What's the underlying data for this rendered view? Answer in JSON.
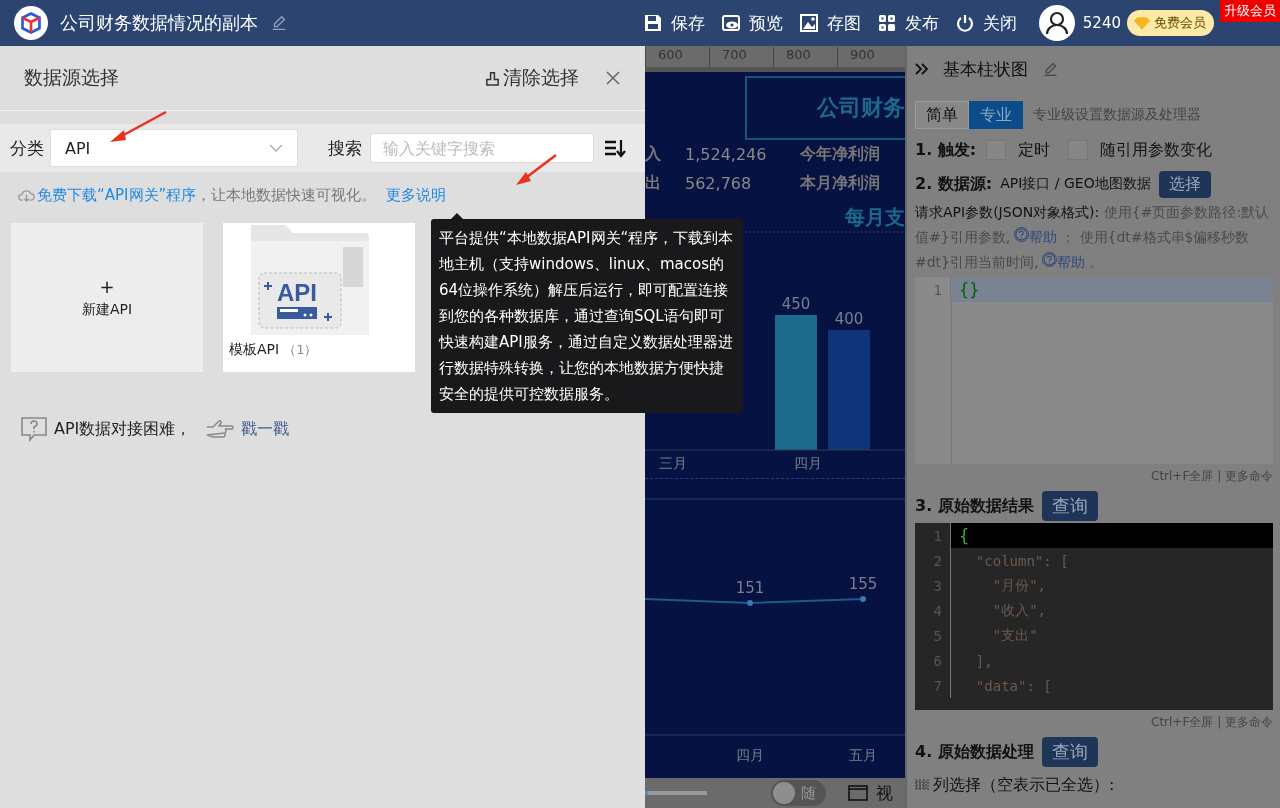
{
  "header": {
    "title": "公司财务数据情况的副本",
    "actions": [
      {
        "kind": "save",
        "label": "保存"
      },
      {
        "kind": "preview",
        "label": "预览"
      },
      {
        "kind": "image",
        "label": "存图"
      },
      {
        "kind": "publish",
        "label": "发布"
      },
      {
        "kind": "close",
        "label": "关闭"
      }
    ],
    "points": "5240",
    "member_badge": "免费会员",
    "upgrade_tag": "升级会员"
  },
  "datasource_panel": {
    "title": "数据源选择",
    "clear_button": "清除选择",
    "category_label": "分类",
    "category_value": "API",
    "search_label": "搜索",
    "search_placeholder": "输入关键字搜索",
    "info": [
      {
        "kind": "link",
        "text": "免费下载“API网关”程序"
      },
      {
        "kind": "hint",
        "text": "，让本地数据快速可视化。"
      },
      {
        "kind": "more",
        "text": "更多说明"
      }
    ],
    "cards": [
      {
        "kind": "new",
        "plus": "+",
        "label": "新建API"
      },
      {
        "kind": "folder",
        "badge": "API",
        "label": "模板API",
        "count": "（1）"
      }
    ],
    "help_text": "API数据对接困难，",
    "help_link": "戳一戳",
    "tooltip": "平台提供“本地数据API网关“程序，下载到本地主机（支持windows、linux、macos的64位操作系统）解压后运行，即可配置连接到您的各种数据库，通过查询SQL语句即可快速构建API服务，通过自定义数据处理器进行数据特殊转换，让您的本地数据方便快捷安全的提供可控数据服务。"
  },
  "canvas": {
    "ruler": [
      "600",
      "700",
      "800",
      "900"
    ],
    "banner_title": "公司财务",
    "stats": [
      {
        "label": "入",
        "value": "1,524,246",
        "label_2": "今年净利润"
      },
      {
        "label": "出",
        "value": "562,768",
        "label_2": "本月净利润"
      }
    ],
    "bar_title": "每月支",
    "bar_chart": {
      "chart_data": {
        "type": "bar",
        "categories": [
          "三月",
          "四月"
        ],
        "series": [
          {
            "color": "#1d6a8c",
            "values": [
              null,
              450
            ]
          },
          {
            "color": "#10347a",
            "values": [
              null,
              400
            ]
          }
        ],
        "data_labels": true
      }
    },
    "line_chart": {
      "chart_data": {
        "type": "line",
        "categories": [
          "四月",
          "五月"
        ],
        "values": [
          151,
          155
        ],
        "marker": "circle",
        "data_labels": true
      }
    },
    "slider": {
      "level": 0.05
    },
    "toggle": {
      "label": "随",
      "on": false
    },
    "view_label": "视"
  },
  "property_panel": {
    "title": "基本柱状图",
    "tabs": [
      {
        "label": "简单",
        "selected": false
      },
      {
        "label": "专业",
        "selected": true
      }
    ],
    "tab_hint": "专业级设置数据源及处理器",
    "trigger_label": "1. 触发:",
    "triggers": [
      {
        "label": "定时",
        "checked": false
      },
      {
        "label": "随引用参数变化",
        "checked": false
      }
    ],
    "source_label": "2. 数据源:",
    "source_value": "API接口 / GEO地图数据",
    "source_button": "选择",
    "params_hint": [
      {
        "kind": "label",
        "text": "请求API参数(JSON对象格式):"
      },
      {
        "kind": "hint",
        "text": " 使用{#页面参数路径:默认值#}引用参数,"
      },
      {
        "kind": "link",
        "text": "帮助"
      },
      {
        "kind": "hint",
        "text": "； 使用{dt#格式串$偏移秒数#dt}引用当前时间,"
      },
      {
        "kind": "link",
        "text": "帮助"
      },
      {
        "kind": "hint",
        "text": "。"
      }
    ],
    "params_editor": [
      {
        "number": "1",
        "text": "{}",
        "active": true
      }
    ],
    "editor_footer": "Ctrl+F全屏 | 更多命令",
    "result_label": "3. 原始数据结果",
    "result_button": "查询",
    "result_editor": [
      {
        "number": "1",
        "text": "{",
        "active": true
      },
      {
        "number": "2",
        "text": "  \"column\": [",
        "active": false
      },
      {
        "number": "3",
        "text": "    \"月份\",",
        "active": false
      },
      {
        "number": "4",
        "text": "    \"收入\",",
        "active": false
      },
      {
        "number": "5",
        "text": "    \"支出\"",
        "active": false
      },
      {
        "number": "6",
        "text": "  ],",
        "active": false
      },
      {
        "number": "7",
        "text": "  \"data\": [",
        "active": false
      }
    ],
    "result_footer": "Ctrl+F全屏 | 更多命令",
    "process_label": "4. 原始数据处理",
    "process_button": "查询",
    "column_select": "列选择（空表示已全选）:"
  }
}
